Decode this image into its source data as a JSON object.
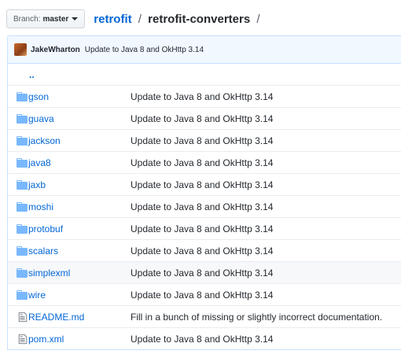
{
  "branch": {
    "label": "Branch:",
    "name": "master"
  },
  "breadcrumb": {
    "repo": "retrofit",
    "separator": "/",
    "path": "retrofit-converters",
    "trailing": "/"
  },
  "latest_commit": {
    "author": "JakeWharton",
    "message": "Update to Java 8 and OkHttp 3.14"
  },
  "parent_dir": "..",
  "rows": [
    {
      "type": "folder",
      "icon": "folder-icon",
      "name": "gson",
      "message": "Update to Java 8 and OkHttp 3.14"
    },
    {
      "type": "folder",
      "icon": "folder-icon",
      "name": "guava",
      "message": "Update to Java 8 and OkHttp 3.14"
    },
    {
      "type": "folder",
      "icon": "folder-icon",
      "name": "jackson",
      "message": "Update to Java 8 and OkHttp 3.14"
    },
    {
      "type": "folder",
      "icon": "folder-icon",
      "name": "java8",
      "message": "Update to Java 8 and OkHttp 3.14"
    },
    {
      "type": "folder",
      "icon": "folder-icon",
      "name": "jaxb",
      "message": "Update to Java 8 and OkHttp 3.14"
    },
    {
      "type": "folder",
      "icon": "folder-icon",
      "name": "moshi",
      "message": "Update to Java 8 and OkHttp 3.14"
    },
    {
      "type": "folder",
      "icon": "folder-icon",
      "name": "protobuf",
      "message": "Update to Java 8 and OkHttp 3.14"
    },
    {
      "type": "folder",
      "icon": "folder-icon",
      "name": "scalars",
      "message": "Update to Java 8 and OkHttp 3.14"
    },
    {
      "type": "folder",
      "icon": "folder-icon",
      "name": "simplexml",
      "message": "Update to Java 8 and OkHttp 3.14"
    },
    {
      "type": "folder",
      "icon": "folder-icon",
      "name": "wire",
      "message": "Update to Java 8 and OkHttp 3.14"
    },
    {
      "type": "file",
      "icon": "file-icon",
      "name": "README.md",
      "message": "Fill in a bunch of missing or slightly incorrect documentation."
    },
    {
      "type": "file",
      "icon": "file-icon",
      "name": "pom.xml",
      "message": "Update to Java 8 and OkHttp 3.14"
    }
  ],
  "colors": {
    "link": "#0366d6",
    "folder_icon": "#79b8ff",
    "file_icon": "#6a737d",
    "header_bg": "#f1f8ff",
    "hover_row": "#f6f8fa"
  }
}
